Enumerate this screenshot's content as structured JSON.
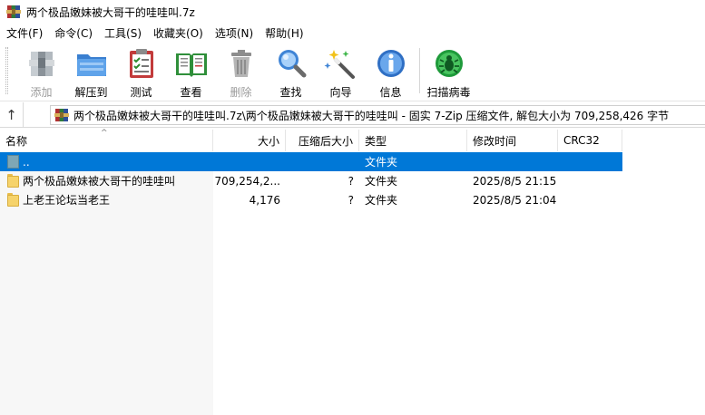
{
  "window": {
    "title": "两个极品嫩妹被大哥干的哇哇叫.7z"
  },
  "menu": [
    {
      "label": "文件(F)"
    },
    {
      "label": "命令(C)"
    },
    {
      "label": "工具(S)"
    },
    {
      "label": "收藏夹(O)"
    },
    {
      "label": "选项(N)"
    },
    {
      "label": "帮助(H)"
    }
  ],
  "toolbar": {
    "add": {
      "label": "添加",
      "icon": "add-archive-icon",
      "enabled": false
    },
    "extract": {
      "label": "解压到",
      "icon": "extract-folder-icon",
      "enabled": true
    },
    "test": {
      "label": "测试",
      "icon": "test-clipboard-icon",
      "enabled": true
    },
    "view": {
      "label": "查看",
      "icon": "view-book-icon",
      "enabled": true
    },
    "delete": {
      "label": "删除",
      "icon": "trash-icon",
      "enabled": false
    },
    "find": {
      "label": "查找",
      "icon": "magnifier-icon",
      "enabled": true
    },
    "wizard": {
      "label": "向导",
      "icon": "magic-wand-icon",
      "enabled": true
    },
    "info": {
      "label": "信息",
      "icon": "info-icon",
      "enabled": true
    },
    "virus": {
      "label": "扫描病毒",
      "icon": "virus-bug-icon",
      "enabled": true
    }
  },
  "address": {
    "path": "两个极品嫩妹被大哥干的哇哇叫.7z\\两个极品嫩妹被大哥干的哇哇叫 - 固实 7-Zip 压缩文件, 解包大小为 709,258,426 字节"
  },
  "columns": {
    "name": "名称",
    "size": "大小",
    "packed": "压缩后大小",
    "type": "类型",
    "modified": "修改时间",
    "crc": "CRC32"
  },
  "rows": [
    {
      "name": "..",
      "size": "",
      "packed": "",
      "type": "文件夹",
      "modified": "",
      "crc": "",
      "selected": true,
      "icon": "up-folder-icon"
    },
    {
      "name": "两个极品嫩妹被大哥干的哇哇叫",
      "size": "709,254,2...",
      "packed": "?",
      "type": "文件夹",
      "modified": "2025/8/5 21:15",
      "crc": "",
      "selected": false,
      "icon": "folder-icon"
    },
    {
      "name": "上老王论坛当老王",
      "size": "4,176",
      "packed": "?",
      "type": "文件夹",
      "modified": "2025/8/5 21:04",
      "crc": "",
      "selected": false,
      "icon": "folder-icon"
    }
  ],
  "colors": {
    "selection": "#0078d7",
    "folder": "#f6d36b"
  }
}
